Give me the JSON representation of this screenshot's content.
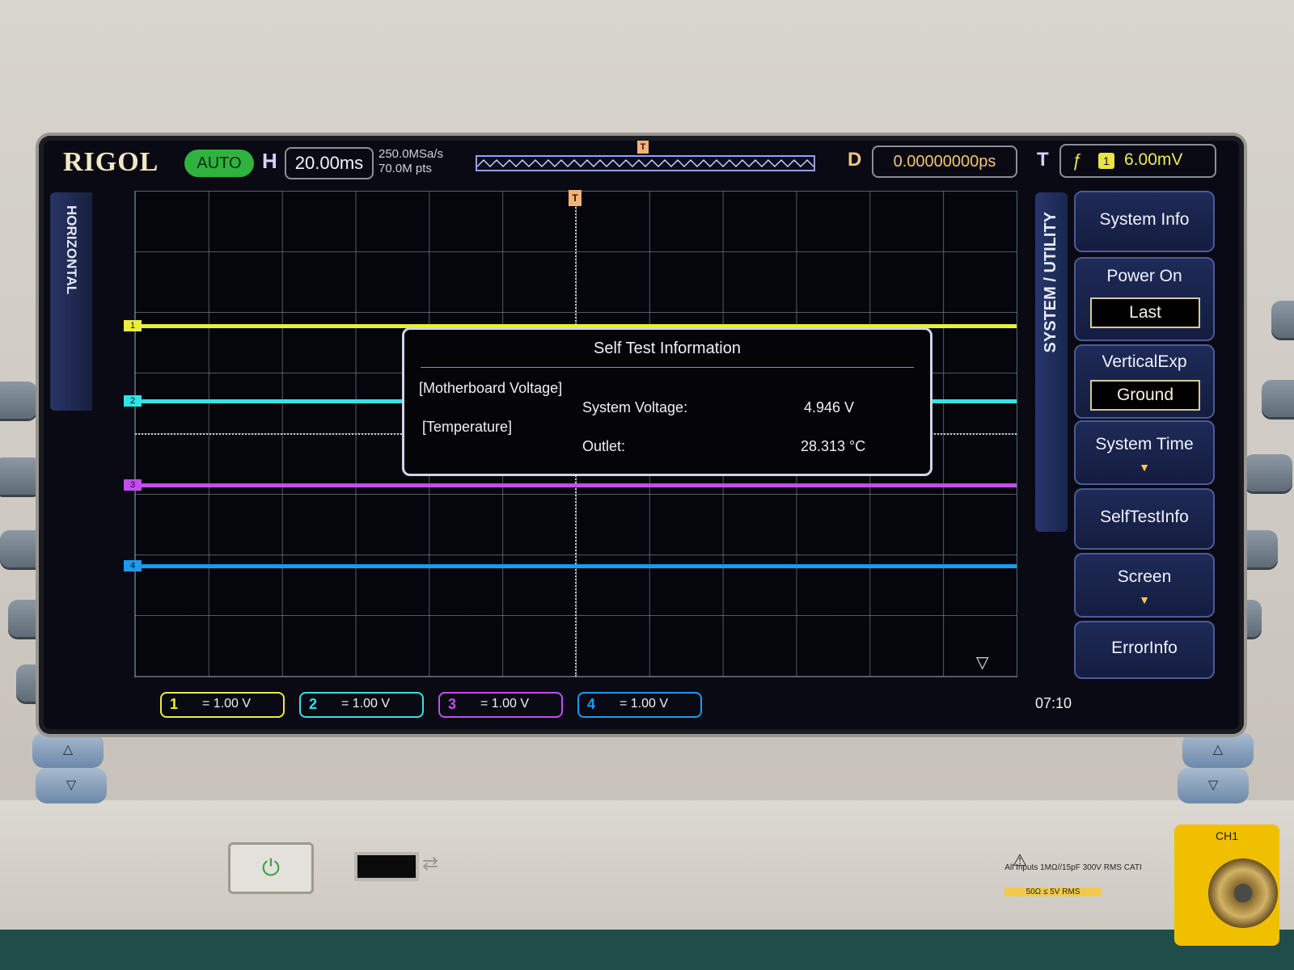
{
  "brand": "RIGOL",
  "run_status": "AUTO",
  "horizontal": {
    "label": "H",
    "timebase": "20.00ms",
    "sample_rate": "250.0MSa/s",
    "memory_depth": "70.0M pts",
    "tab_label": "HORIZONTAL"
  },
  "delay": {
    "label": "D",
    "value": "0.00000000ps"
  },
  "trigger": {
    "label": "T",
    "edge_symbol": "ƒ",
    "source": "1",
    "level": "6.00mV",
    "marker": "T"
  },
  "channels": [
    {
      "num": "1",
      "scale": "= 1.00 V",
      "color": "#e9ef3a"
    },
    {
      "num": "2",
      "scale": "= 1.00 V",
      "color": "#2fe4e6"
    },
    {
      "num": "3",
      "scale": "= 1.00 V",
      "color": "#c54cf2"
    },
    {
      "num": "4",
      "scale": "= 1.00 V",
      "color": "#1a9bf0"
    }
  ],
  "dialog": {
    "title": "Self Test Information",
    "section1": "[Motherboard Voltage]",
    "sys_voltage_label": "System Voltage:",
    "sys_voltage_value": "4.946 V",
    "section2": "[Temperature]",
    "outlet_label": "Outlet:",
    "outlet_value": "28.313 °C"
  },
  "menu": {
    "title": "SYSTEM / UTILITY",
    "items": [
      {
        "label": "System Info"
      },
      {
        "label": "Power On",
        "value": "Last"
      },
      {
        "label": "VerticalExp",
        "value": "Ground"
      },
      {
        "label": "System Time",
        "arrow": "▼"
      },
      {
        "label": "SelfTestInfo"
      },
      {
        "label": "Screen",
        "arrow": "▼"
      },
      {
        "label": "ErrorInfo"
      }
    ]
  },
  "clock": "07:10",
  "front_panel": {
    "ch1_label": "CH1",
    "warning_line1": "All Inputs 1MΩ//15pF 300V RMS CATI",
    "warning_line2": "50Ω ≤ 5V RMS"
  },
  "colors": {
    "auto_green": "#2fb33e",
    "trigger_orange": "#f2b37a",
    "menu_blue": "#27366a"
  }
}
